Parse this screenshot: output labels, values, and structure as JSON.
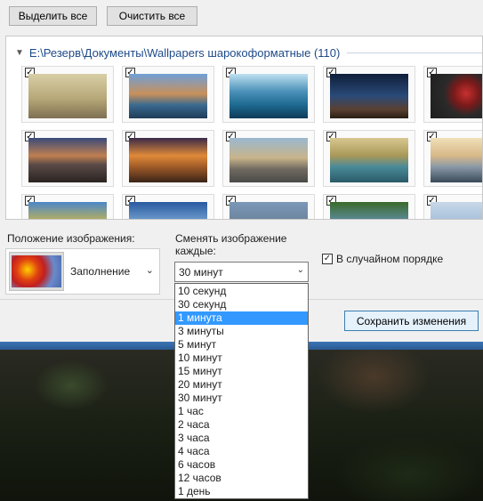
{
  "toolbar": {
    "select_all_label": "Выделить все",
    "clear_all_label": "Очистить все"
  },
  "gallery": {
    "folder_title": "E:\\Резерв\\Документы\\Wallpapers шарокоформатные (110)",
    "thumbnails_checked": true
  },
  "position": {
    "label": "Положение изображения:",
    "value": "Заполнение"
  },
  "interval": {
    "label": "Сменять изображение каждые:",
    "value": "30 минут",
    "options": [
      "10 секунд",
      "30 секунд",
      "1 минута",
      "3 минуты",
      "5 минут",
      "10 минут",
      "15 минут",
      "20 минут",
      "30 минут",
      "1 час",
      "2 часа",
      "3 часа",
      "4 часа",
      "6 часов",
      "12 часов",
      "1 день"
    ],
    "highlighted": "1 минута"
  },
  "shuffle": {
    "label": "В случайном порядке",
    "checked": true
  },
  "save_label": "Сохранить изменения",
  "colors": {
    "accent": "#3399ff",
    "folder_link": "#1e4a8a",
    "taskbar": "#2a5a93"
  }
}
